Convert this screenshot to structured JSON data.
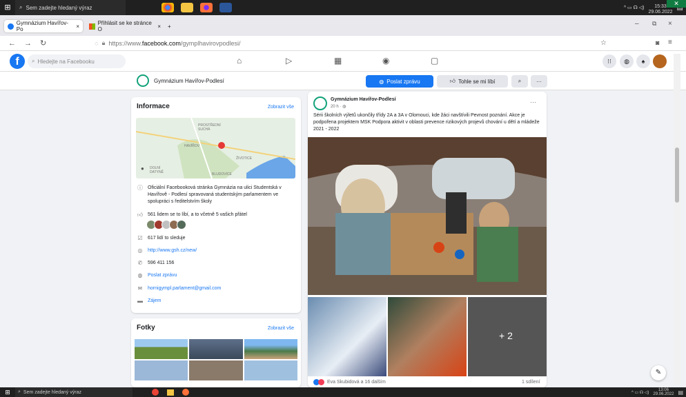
{
  "taskbar_top": {
    "search": "Sem zadejte hledaný výraz",
    "time": "15:33",
    "date": "29.06.2022"
  },
  "tabs": [
    {
      "label": "Gymnázium Havířov-Po",
      "close": "×"
    },
    {
      "label": "Přihlásit se ke stránce O",
      "close": "×"
    }
  ],
  "new_tab": "+",
  "url": {
    "prefix": "https://www.",
    "domain": "facebook.com",
    "path": "/gymplhavirovpodlesi/"
  },
  "fb": {
    "search_placeholder": "Hledejte na Facebooku"
  },
  "page": {
    "name": "Gymnázium Havířov-Podlesí",
    "message_button": "Poslat zprávu",
    "like_button": "Tohle se mi líbí",
    "more": "···"
  },
  "info": {
    "title": "Informace",
    "see_all": "Zobrazit vše",
    "map_labels": [
      "PROSTŘEDNÍ SUCHÁ",
      "HAVÍŘOV",
      "ŽIVOTICE",
      "DOLNÍ DATYNĚ",
      "BLUDOVICE"
    ],
    "description": "Oficiální Facebooková stránka Gymnázia na ulici Studentská v Havířově - Podlesí spravovaná studentským parlamentem ve spolupráci s ředitelstvím školy",
    "likes": "561 lidem se to líbí, a to včetně 5 vašich přátel",
    "followers": "617 lidí to sleduje",
    "website": "http://www.gsh.cz/new/",
    "phone": "596 411 156",
    "message": "Poslat zprávu",
    "email": "hornigympl.parlament@gmail.com",
    "category": "Zájem"
  },
  "photos": {
    "title": "Fotky",
    "see_all": "Zobrazit vše"
  },
  "post": {
    "author": "Gymnázium Havířov-Podlesí",
    "time": "20 h · ",
    "text": "Sérii školních výletů ukončily třídy  2A a 3A v Olomouci, kde žáci navštívili Pevnost poznání. Akce je podpořena projektem MSK Podpora aktivit v oblasti prevence rizikových projevů chování u dětí a mládeže 2021 - 2022",
    "more_count": "+ 2",
    "reactions": "Eva Skubidová a 16 dalším",
    "shares": "1 sdílení"
  },
  "taskbar_bot": {
    "search": "Sem zadejte hledaný výraz",
    "time": "13:06",
    "date": "29.06.2022"
  },
  "colors": {
    "fb_blue": "#1877f2",
    "taskbar": "#202020",
    "page_green": "#12a27a"
  }
}
